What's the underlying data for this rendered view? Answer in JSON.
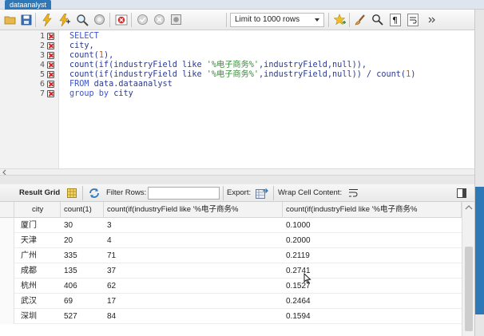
{
  "tab": {
    "label": "dataanalyst"
  },
  "toolbar": {
    "limit_label": "Limit to 1000 rows"
  },
  "editor": {
    "lines": [
      {
        "num": "1",
        "parts": [
          [
            "kw",
            "SELECT"
          ]
        ]
      },
      {
        "num": "2",
        "parts": [
          [
            "plain",
            "city,"
          ]
        ]
      },
      {
        "num": "3",
        "parts": [
          [
            "plain",
            "count("
          ],
          [
            "num",
            "1"
          ],
          [
            "plain",
            "),"
          ]
        ]
      },
      {
        "num": "4",
        "parts": [
          [
            "plain",
            "count(if(industryField like "
          ],
          [
            "str",
            "'%电子商务%'"
          ],
          [
            "plain",
            ",industryField,null)),"
          ]
        ]
      },
      {
        "num": "5",
        "parts": [
          [
            "plain",
            "count(if(industryField like "
          ],
          [
            "str",
            "'%电子商务%'"
          ],
          [
            "plain",
            ",industryField,null)) / count("
          ],
          [
            "num",
            "1"
          ],
          [
            "plain",
            ")"
          ]
        ]
      },
      {
        "num": "6",
        "parts": [
          [
            "kw",
            "FROM"
          ],
          [
            "plain",
            " data.dataanalyst"
          ]
        ]
      },
      {
        "num": "7",
        "parts": [
          [
            "kw",
            "group by"
          ],
          [
            "plain",
            " city"
          ]
        ]
      }
    ]
  },
  "results": {
    "result_grid_label": "Result Grid",
    "filter_rows_label": "Filter Rows:",
    "filter_value": "",
    "export_label": "Export:",
    "wrap_label": "Wrap Cell Content:",
    "columns": [
      "city",
      "count(1)",
      "count(if(industryField like '%电子商务%",
      "count(if(industryField like '%电子商务%"
    ],
    "rows": [
      [
        "厦门",
        "30",
        "3",
        "0.1000"
      ],
      [
        "天津",
        "20",
        "4",
        "0.2000"
      ],
      [
        "广州",
        "335",
        "71",
        "0.2119"
      ],
      [
        "成都",
        "135",
        "37",
        "0.2741"
      ],
      [
        "杭州",
        "406",
        "62",
        "0.1527"
      ],
      [
        "武汉",
        "69",
        "17",
        "0.2464"
      ],
      [
        "深圳",
        "527",
        "84",
        "0.1594"
      ]
    ]
  }
}
